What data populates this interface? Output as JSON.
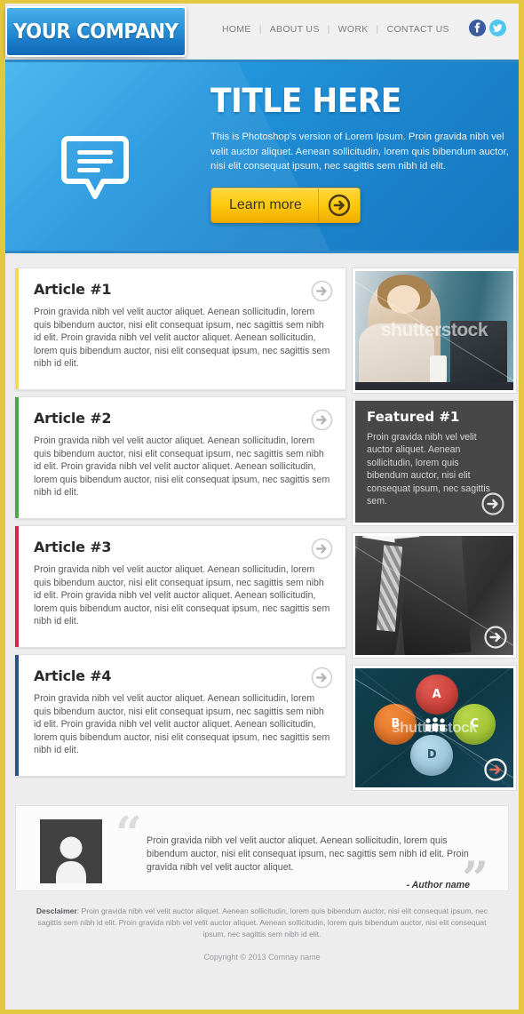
{
  "header": {
    "logo_text": "YOUR COMPANY",
    "nav": [
      {
        "label": "HOME"
      },
      {
        "label": "ABOUT US"
      },
      {
        "label": "WORK"
      },
      {
        "label": "CONTACT US"
      }
    ],
    "separator": "|",
    "social": [
      {
        "name": "facebook",
        "glyph": "f",
        "color": "#3a5ba0"
      },
      {
        "name": "twitter",
        "glyph": "•",
        "color": "#51c7f0"
      }
    ]
  },
  "hero": {
    "title": "TITLE HERE",
    "text": "This is Photoshop's version  of Lorem Ipsum. Proin gravida nibh vel velit auctor aliquet. Aenean sollicitudin, lorem quis bibendum auctor, nisi elit consequat ipsum, nec sagittis sem nibh id elit.",
    "button_label": "Learn more",
    "icon": "speech-bubble-icon",
    "bg_color": "#2397de",
    "button_color": "#fdc80c"
  },
  "articles": [
    {
      "title": "Article #1",
      "body": "Proin gravida nibh vel velit auctor aliquet. Aenean sollicitudin, lorem quis bibendum auctor, nisi elit consequat ipsum, nec sagittis sem nibh id elit. Proin gravida nibh vel velit auctor aliquet. Aenean sollicitudin, lorem quis bibendum auctor, nisi elit consequat ipsum, nec sagittis sem nibh id elit.",
      "accent_color": "#efd85e"
    },
    {
      "title": "Article #2",
      "body": "Proin gravida nibh vel velit auctor aliquet. Aenean sollicitudin, lorem quis bibendum auctor, nisi elit consequat ipsum, nec sagittis sem nibh id elit. Proin gravida nibh vel velit auctor aliquet. Aenean sollicitudin, lorem quis bibendum auctor, nisi elit consequat ipsum, nec sagittis sem nibh id elit.",
      "accent_color": "#4aa942"
    },
    {
      "title": "Article #3",
      "body": "Proin gravida nibh vel velit auctor aliquet. Aenean sollicitudin, lorem quis bibendum auctor, nisi elit consequat ipsum, nec sagittis sem nibh id elit. Proin gravida nibh vel velit auctor aliquet. Aenean sollicitudin, lorem quis bibendum auctor, nisi elit consequat ipsum, nec sagittis sem nibh id elit.",
      "accent_color": "#d8283f"
    },
    {
      "title": "Article #4",
      "body": "Proin gravida nibh vel velit auctor aliquet. Aenean sollicitudin, lorem quis bibendum auctor, nisi elit consequat ipsum, nec sagittis sem nibh id elit. Proin gravida nibh vel velit auctor aliquet. Aenean sollicitudin, lorem quis bibendum auctor, nisi elit consequat ipsum, nec sagittis sem nibh id elit.",
      "accent_color": "#2e4f87"
    }
  ],
  "sidebar": {
    "photo1": {
      "name": "businesswoman-at-laptop-photo",
      "watermark": "shutterstock"
    },
    "featured": {
      "title": "Featured #1",
      "body": "Proin gravida nibh vel velit auctor aliquet. Aenean sollicitudin, lorem quis bibendum auctor, nisi elit consequat ipsum, nec sagittis sem.",
      "bg_color": "#474747"
    },
    "photo2": {
      "name": "businessman-suit-tie-photo",
      "watermark": "shutterstock"
    },
    "photo3": {
      "name": "infographic-bubbles-photo",
      "watermark": "shutterstock",
      "bubbles": [
        {
          "label": "A",
          "color": "#c0342c"
        },
        {
          "label": "B",
          "color": "#dd6a1c"
        },
        {
          "label": "C",
          "color": "#94bb2a"
        },
        {
          "label": "D",
          "color": "#8cbdd6"
        }
      ]
    }
  },
  "testimonial": {
    "quote": "Proin gravida nibh vel velit auctor aliquet. Aenean sollicitudin, lorem quis bibendum auctor, nisi elit consequat ipsum, nec sagittis sem nibh id elit. Proin gravida nibh vel velit auctor aliquet.",
    "author": "- Author name",
    "open_quote": "“",
    "close_quote": "”",
    "avatar": "user-avatar-icon"
  },
  "footer": {
    "disclaimer_label": "Desclaimer",
    "disclaimer_text": ": Proin gravida nibh vel velit auctor aliquet. Aenean sollicitudin, lorem quis bibendum auctor, nisi elit consequat ipsum, nec sagittis sem nibh id elit. Proin gravida nibh vel velit auctor aliquet. Aenean sollicitudin, lorem quis bibendum auctor, nisi elit consequat ipsum, nec sagittis sem nibh id elit.",
    "copyright": "Copyright © 2013 Comnay name"
  },
  "theme": {
    "border_color": "#e2c73f",
    "page_bg": "#ededee"
  }
}
